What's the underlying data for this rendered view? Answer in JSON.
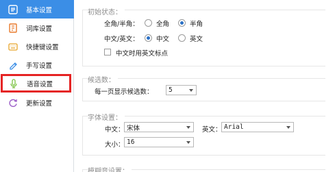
{
  "sidebar": {
    "items": [
      {
        "label": "基本设置",
        "icon": "gear-icon"
      },
      {
        "label": "词库设置",
        "icon": "dictionary-icon"
      },
      {
        "label": "快捷键设置",
        "icon": "keyboard-icon"
      },
      {
        "label": "手写设置",
        "icon": "pen-icon"
      },
      {
        "label": "语音设置",
        "icon": "microphone-icon"
      },
      {
        "label": "更新设置",
        "icon": "refresh-icon"
      }
    ],
    "active_color": "#3b8ee6",
    "highlight_color": "#e52323"
  },
  "initial_state": {
    "title": "初始状态：",
    "width_label": "全角/半角：",
    "full_width": "全角",
    "half_width": "半角",
    "lang_label": "中文/英文：",
    "chinese": "中文",
    "english": "英文",
    "punct_label": "中文时用英文标点"
  },
  "candidates": {
    "title": "候选数：",
    "per_page_label": "每一页显示候选数：",
    "per_page_value": "5"
  },
  "font": {
    "title": "字体设置：",
    "chinese_label": "中文：",
    "chinese_value": "宋体",
    "english_label": "英文：",
    "english_value": "Arial",
    "size_label": "大小：",
    "size_value": "16"
  },
  "fuzzy": {
    "title": "模糊音设置："
  }
}
